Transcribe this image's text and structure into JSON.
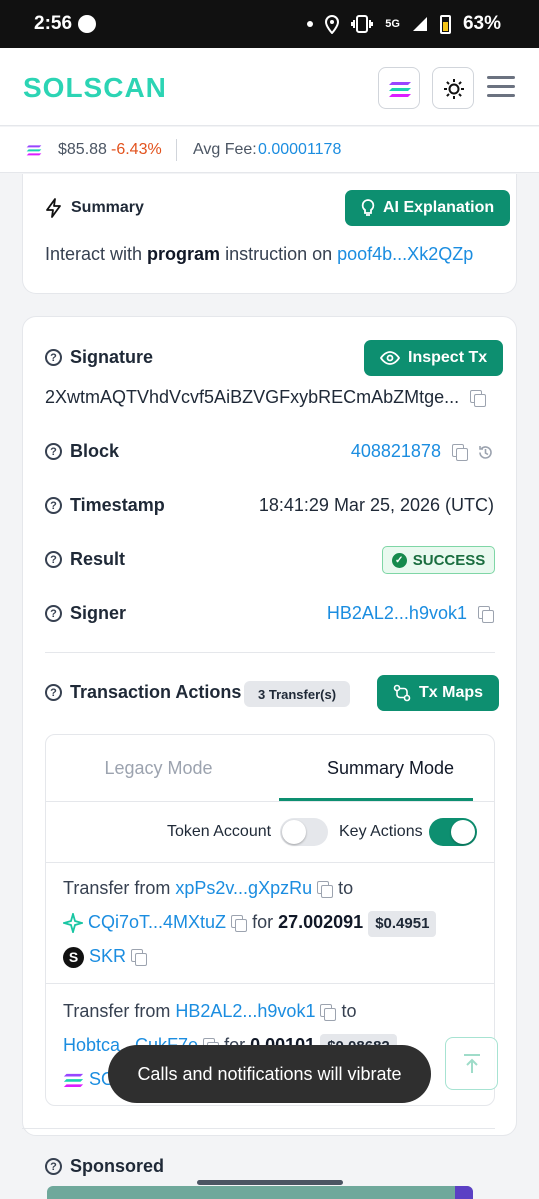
{
  "statusbar": {
    "time": "2:56",
    "network": "5G",
    "battery": "63%"
  },
  "header": {
    "logo": "SOLSCAN"
  },
  "pricebar": {
    "sol_price": "$85.88",
    "change": "-6.43%",
    "fee_label": "Avg Fee:",
    "fee_value": "0.00001178"
  },
  "summary": {
    "title": "Summary",
    "ai_button": "AI Explanation",
    "text_prefix": "Interact with ",
    "text_bold": "program",
    "text_mid": " instruction on ",
    "program_link": "poof4b...Xk2QZp"
  },
  "details": {
    "signature_label": "Signature",
    "inspect_button": "Inspect Tx",
    "signature_value": "2XwtmAQTVhdVcvf5AiBZVGFxybRECmAbZMtge...",
    "block_label": "Block",
    "block_value": "408821878",
    "timestamp_label": "Timestamp",
    "timestamp_value": "18:41:29 Mar 25, 2026 (UTC)",
    "result_label": "Result",
    "result_value": "SUCCESS",
    "signer_label": "Signer",
    "signer_value": "HB2AL2...h9vok1"
  },
  "actions": {
    "title": "Transaction Actions",
    "badge": "3 Transfer(s)",
    "maps_button": "Tx Maps",
    "tabs": [
      "Legacy Mode",
      "Summary Mode"
    ],
    "toggle_token_account": "Token Account",
    "toggle_key_actions": "Key Actions",
    "transfers": [
      {
        "from_label": "Transfer from ",
        "from": "xpPs2v...gXpzRu",
        "to_label": " to",
        "to": "CQi7oT...4MXtuZ",
        "for_label": " for ",
        "amount": "27.002091",
        "usd": "$0.4951",
        "token": "SKR"
      },
      {
        "from_label": "Transfer from ",
        "from": "HB2AL2...h9vok1",
        "to_label": " to",
        "to": "Hobtca...CukF7e",
        "for_label": " for ",
        "amount": "0.00101",
        "usd": "$0.08682",
        "token": "SOL"
      }
    ]
  },
  "sponsored": {
    "label": "Sponsored"
  },
  "toast": {
    "text": "Calls and notifications will vibrate"
  }
}
